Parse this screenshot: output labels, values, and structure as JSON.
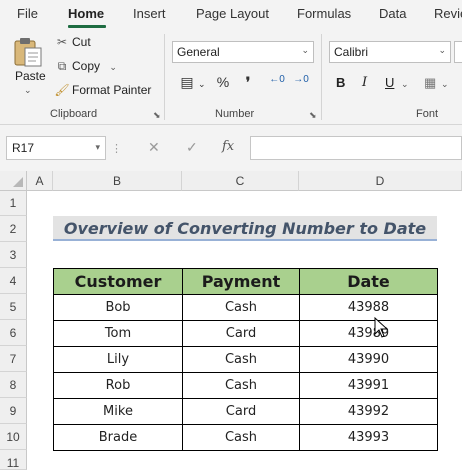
{
  "ribbon_tabs": [
    {
      "label": "File"
    },
    {
      "label": "Home"
    },
    {
      "label": "Insert"
    },
    {
      "label": "Page Layout"
    },
    {
      "label": "Formulas"
    },
    {
      "label": "Data"
    },
    {
      "label": "Revie"
    }
  ],
  "clipboard": {
    "paste_label": "Paste",
    "cut_label": "Cut",
    "copy_label": "Copy",
    "format_painter_label": "Format Painter",
    "group_label": "Clipboard"
  },
  "number": {
    "format_value": "General",
    "group_label": "Number"
  },
  "font": {
    "font_name": "Calibri",
    "bold_label": "B",
    "italic_label": "I",
    "underline_label": "U",
    "group_label": "Font"
  },
  "formula_bar": {
    "name_box": "R17",
    "formula": ""
  },
  "columns": [
    "A",
    "B",
    "C",
    "D"
  ],
  "rows": [
    "1",
    "2",
    "3",
    "4",
    "5",
    "6",
    "7",
    "8",
    "9",
    "10",
    "11"
  ],
  "sheet": {
    "title": "Overview of Converting Number to Date",
    "headers": [
      "Customer",
      "Payment",
      "Date"
    ],
    "records": [
      {
        "customer": "Bob",
        "payment": "Cash",
        "date": "43988"
      },
      {
        "customer": "Tom",
        "payment": "Card",
        "date": "43989"
      },
      {
        "customer": "Lily",
        "payment": "Cash",
        "date": "43990"
      },
      {
        "customer": "Rob",
        "payment": "Cash",
        "date": "43991"
      },
      {
        "customer": "Mike",
        "payment": "Card",
        "date": "43992"
      },
      {
        "customer": "Brade",
        "payment": "Cash",
        "date": "43993"
      }
    ]
  },
  "colors": {
    "accent": "#1e6c41",
    "header_fill": "#a9d08e",
    "title_fill": "#e3e3e3",
    "title_text": "#44546a"
  }
}
